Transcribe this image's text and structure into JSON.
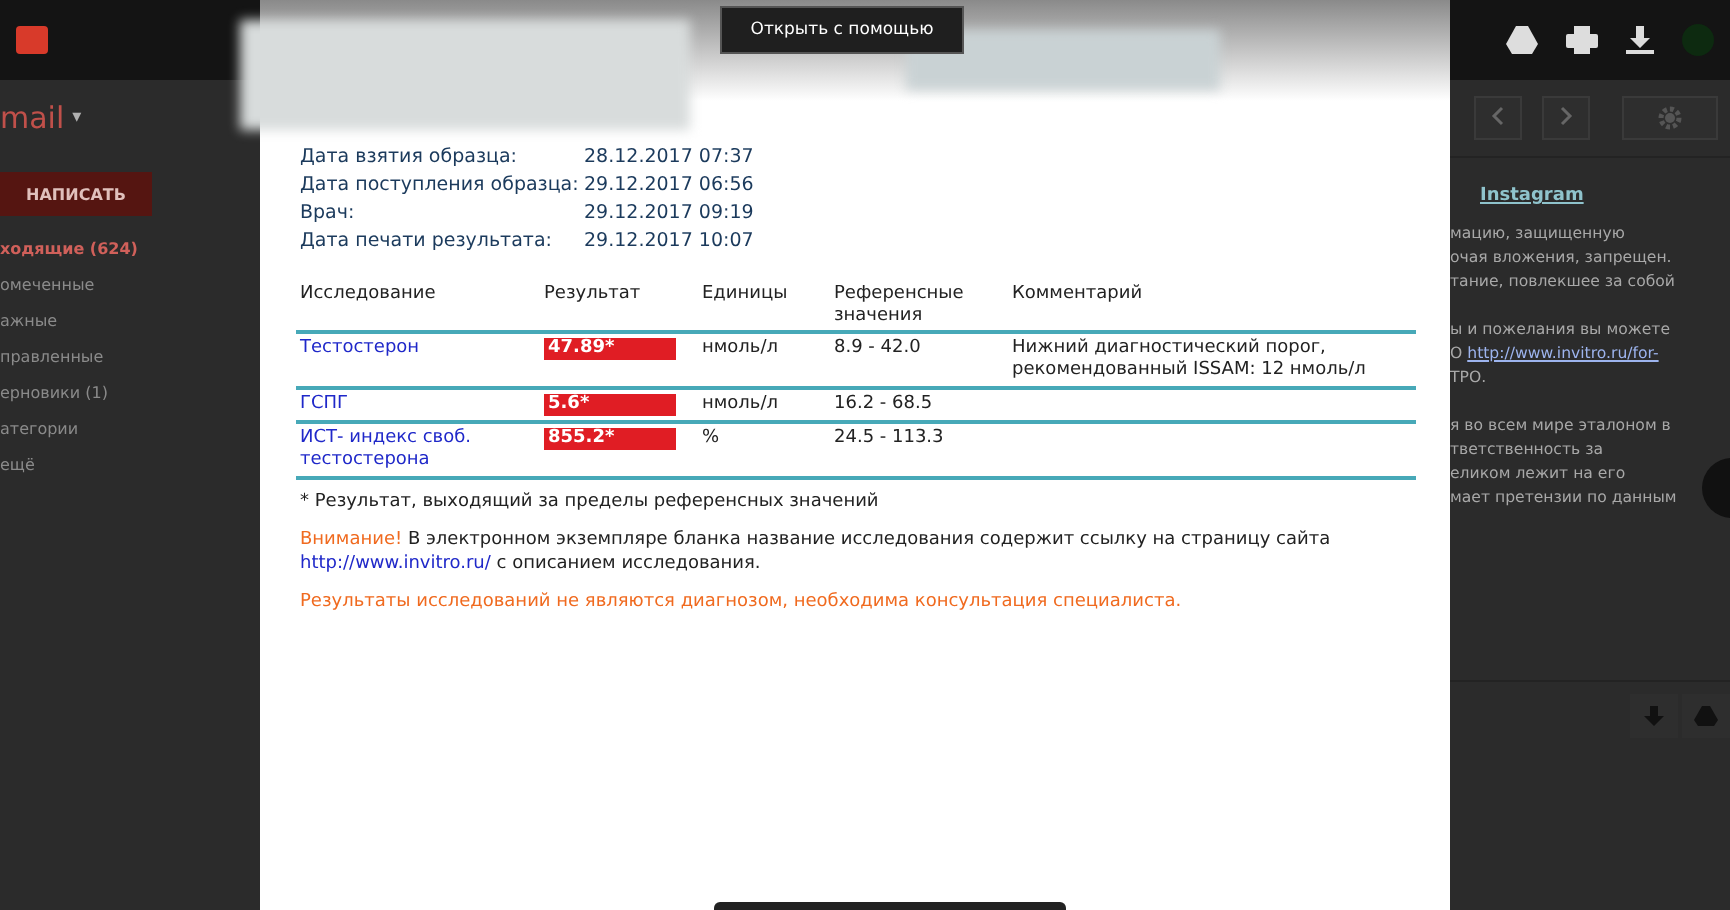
{
  "viewer_toolbar": {
    "open_with_button": "Открыть с помощью"
  },
  "mail_sidebar": {
    "app_label": "mail",
    "app_menu_caret": "▾",
    "compose_button": "НАПИСАТЬ",
    "folders": [
      {
        "label": "ходящие (624)",
        "selected": true
      },
      {
        "label": "омеченные",
        "selected": false
      },
      {
        "label": "ажные",
        "selected": false
      },
      {
        "label": "правленные",
        "selected": false
      },
      {
        "label": "ерновики (1)",
        "selected": false
      },
      {
        "label": "атегории",
        "selected": false
      },
      {
        "label": "ещё",
        "selected": false
      }
    ]
  },
  "mail_body": {
    "sender_link": "Instagram",
    "paragraphs": [
      {
        "lines": [
          "мацию, защищенную",
          "очая вложения, запрещен.",
          "тание, повлекшее за собой"
        ]
      },
      {
        "lines": [
          "ы и пожелания вы можете"
        ],
        "link_prefix": "О ",
        "link": "http://www.invitro.ru/for-",
        "tail": "ТРО."
      },
      {
        "lines": [
          "я во всем мире эталоном в",
          "тветственность за",
          "еликом лежит на его",
          "мает претензии по данным"
        ]
      }
    ]
  },
  "document": {
    "info_rows": [
      {
        "label": "Дата взятия образца:",
        "value": "28.12.2017 07:37"
      },
      {
        "label": "Дата поступления образца:",
        "value": "29.12.2017 06:56"
      },
      {
        "label": "Врач:",
        "value": "29.12.2017 09:19"
      },
      {
        "label": "Дата печати результата:",
        "value": "29.12.2017 10:07"
      }
    ],
    "table": {
      "columns": [
        "Исследование",
        "Результат",
        "Единицы",
        "Референсные значения",
        "Комментарий"
      ],
      "rows": [
        {
          "test": "Тестостерон",
          "result": "47.89*",
          "abnormal": true,
          "units": "нмоль/л",
          "reference": "8.9 - 42.0",
          "comment": "Нижний диагностический порог, рекомендованный ISSAM: 12 нмоль/л"
        },
        {
          "test": "ГСПГ",
          "result": "5.6*",
          "abnormal": true,
          "units": "нмоль/л",
          "reference": "16.2 - 68.5"
        },
        {
          "test": "ИСТ- индекс своб. тестостерона",
          "result": "855.2*",
          "abnormal": true,
          "units": "%",
          "reference": "24.5 - 113.3"
        }
      ]
    },
    "footnote": "* Результат, выходящий за пределы референсных значений",
    "notice": {
      "warning": "Внимание!",
      "text": " В электронном экземпляре бланка название исследования содержит ссылку на страницу сайта",
      "link": "http://www.invitro.ru/",
      "text_after": " с описанием исследования."
    },
    "disclaimer": "Результаты исследований не являются диагнозом, необходима консультация специалиста."
  }
}
